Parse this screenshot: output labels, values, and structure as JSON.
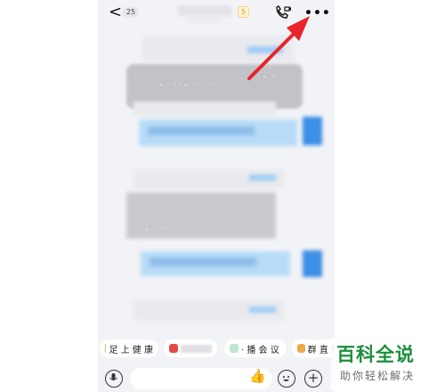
{
  "header": {
    "back_glyph": "<",
    "unread_count": "25",
    "level_badge": "5",
    "more_glyph": "•••"
  },
  "chat": {
    "bubble_text_1": "· 。 · ; ; 。 · · · · ·",
    "bubble_text_2": "· 。 ·· ·",
    "grey_text": "· 。 · · ·"
  },
  "toolbar": {
    "chip1_label": "足 上 健 康",
    "chip2_label": "",
    "chip3_label": "· 播 会 议",
    "chip4_label": "群 直 播"
  },
  "input": {
    "plus_glyph": "+",
    "like_glyph": "👍"
  },
  "watermark": {
    "title": "百科全说",
    "subtitle": "助你轻松解决"
  },
  "colors": {
    "arrow": "#e8242a",
    "watermark_green": "#1a8f3c"
  }
}
